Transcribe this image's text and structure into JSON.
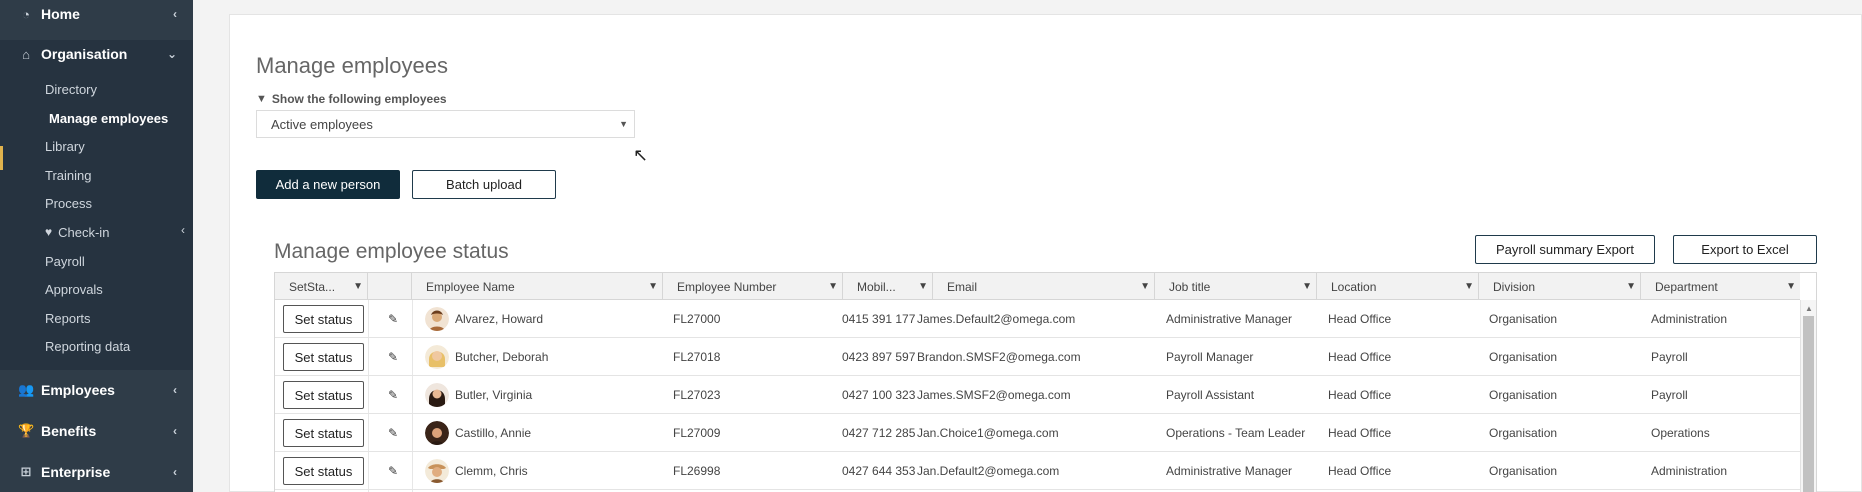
{
  "sidebar": {
    "home": "Home",
    "organisation": "Organisation",
    "sub_items": [
      "Directory",
      "Manage employees",
      "Library",
      "Training",
      "Process",
      "Check-in",
      "Payroll",
      "Approvals",
      "Reports",
      "Reporting data"
    ],
    "employees": "Employees",
    "benefits": "Benefits",
    "enterprise": "Enterprise"
  },
  "page": {
    "title": "Manage employees",
    "filter_label": "Show the following employees",
    "filter_value": "Active employees",
    "add_button": "Add a new person",
    "batch_button": "Batch upload"
  },
  "status_section": {
    "title": "Manage employee status",
    "payroll_export": "Payroll summary Export",
    "excel_export": "Export to Excel"
  },
  "table": {
    "headers": [
      "SetSta...",
      "",
      "Employee Name",
      "Employee Number",
      "Mobil...",
      "Email",
      "Job title",
      "Location",
      "Division",
      "Department"
    ],
    "set_status_label": "Set status",
    "rows": [
      {
        "name": "Alvarez, Howard",
        "number": "FL27000",
        "mobile": "0415 391 177",
        "email": "James.Default2@omega.com",
        "job": "Administrative Manager",
        "location": "Head Office",
        "division": "Organisation",
        "department": "Administration"
      },
      {
        "name": "Butcher, Deborah",
        "number": "FL27018",
        "mobile": "0423 897 597",
        "email": "Brandon.SMSF2@omega.com",
        "job": "Payroll Manager",
        "location": "Head Office",
        "division": "Organisation",
        "department": "Payroll"
      },
      {
        "name": "Butler, Virginia",
        "number": "FL27023",
        "mobile": "0427 100 323",
        "email": "James.SMSF2@omega.com",
        "job": "Payroll Assistant",
        "location": "Head Office",
        "division": "Organisation",
        "department": "Payroll"
      },
      {
        "name": "Castillo, Annie",
        "number": "FL27009",
        "mobile": "0427 712 285",
        "email": "Jan.Choice1@omega.com",
        "job": "Operations - Team Leader",
        "location": "Head Office",
        "division": "Organisation",
        "department": "Operations"
      },
      {
        "name": "Clemm, Chris",
        "number": "FL26998",
        "mobile": "0427 644 353",
        "email": "Jan.Default2@omega.com",
        "job": "Administrative Manager",
        "location": "Head Office",
        "division": "Organisation",
        "department": "Administration"
      }
    ]
  },
  "colors": {
    "sidebar_bg": "#2f3c48",
    "sidebar_active_bg": "#263340",
    "active_accent": "#e0b34d",
    "primary_button": "#102c3b"
  }
}
